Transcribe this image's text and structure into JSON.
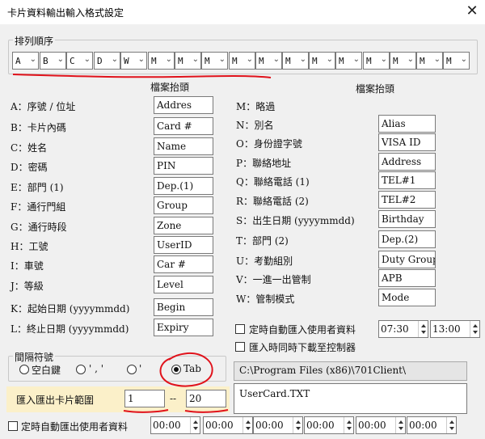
{
  "window": {
    "title": "卡片資料輸出輸入格式設定",
    "close_glyph": "✕"
  },
  "order_group": {
    "legend": "排列順序",
    "combos": [
      "A",
      "B",
      "C",
      "D",
      "W",
      "M",
      "M",
      "M",
      "M",
      "M",
      "M",
      "M",
      "M",
      "M",
      "M",
      "M",
      "M"
    ]
  },
  "left_header": "檔案抬頭",
  "right_header": "檔案抬頭",
  "left_fields": [
    {
      "label": "A：序號 / 位址",
      "value": "Addres"
    },
    {
      "label": "B：卡片內碼",
      "value": "Card #"
    },
    {
      "label": "C：姓名",
      "value": "Name"
    },
    {
      "label": "D：密碼",
      "value": "PIN"
    },
    {
      "label": "E：部門 (1)",
      "value": "Dep.(1)"
    },
    {
      "label": "F：通行門組",
      "value": "Group"
    },
    {
      "label": "G：通行時段",
      "value": "Zone"
    },
    {
      "label": "H：工號",
      "value": "UserID"
    },
    {
      "label": "I：車號",
      "value": "Car #"
    },
    {
      "label": "J：等級",
      "value": "Level"
    },
    {
      "label": "K：起始日期 (yyyymmdd)",
      "value": "Begin"
    },
    {
      "label": "L：終止日期 (yyyymmdd)",
      "value": "Expiry"
    }
  ],
  "right_fields": [
    {
      "label": "M：略過",
      "value": ""
    },
    {
      "label": "N：別名",
      "value": "Alias"
    },
    {
      "label": "O：身份證字號",
      "value": "VISA ID"
    },
    {
      "label": "P：聯絡地址",
      "value": "Address"
    },
    {
      "label": "Q：聯絡電話 (1)",
      "value": "TEL#1"
    },
    {
      "label": "R：聯絡電話 (2)",
      "value": "TEL#2"
    },
    {
      "label": "S：出生日期 (yyyymmdd)",
      "value": "Birthday"
    },
    {
      "label": "T：部門 (2)",
      "value": "Dep.(2)"
    },
    {
      "label": "U：考勤組別",
      "value": "Duty Group"
    },
    {
      "label": "V：一進一出管制",
      "value": "APB"
    },
    {
      "label": "W：管制模式",
      "value": "Mode"
    }
  ],
  "auto_import": {
    "label": "定時自動匯入使用者資料",
    "time_from": "07:30",
    "time_to": "13:00"
  },
  "download_on_import": {
    "label": "匯入時同時下載至控制器"
  },
  "path_field": "C:\\Program Files (x86)\\701Client\\",
  "file_field": "UserCard.TXT",
  "separator": {
    "legend": "間隔符號",
    "options": [
      {
        "label": "空白鍵",
        "selected": false
      },
      {
        "label": "' , '",
        "selected": false
      },
      {
        "label": "'",
        "selected": false
      },
      {
        "label": "Tab",
        "selected": true
      }
    ]
  },
  "range": {
    "label": "匯入匯出卡片範圍",
    "from": "1",
    "sep": "--",
    "to": "20"
  },
  "auto_export": {
    "label": "定時自動匯出使用者資料",
    "times": [
      "00:00",
      "00:00",
      "00:00",
      "00:00",
      "00:00",
      "00:00"
    ]
  },
  "colors": {
    "annotation": "#e0121b",
    "highlight": "#fbf0c9"
  }
}
